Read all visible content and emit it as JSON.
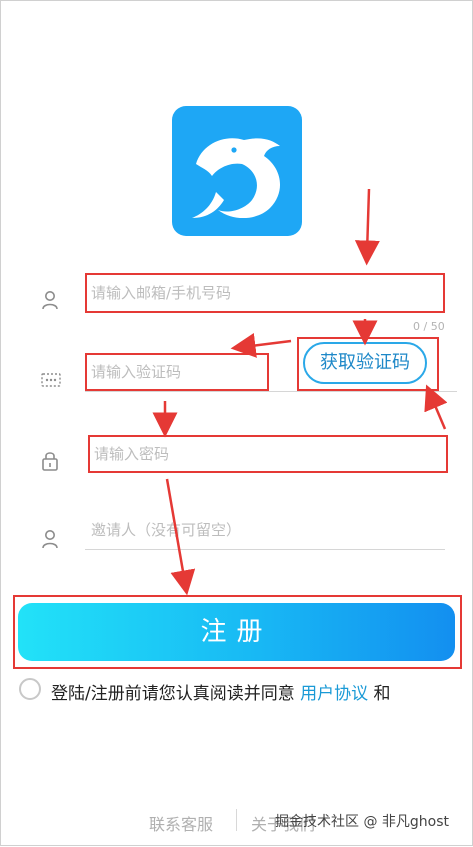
{
  "logo": {
    "icon": "dolphin-icon",
    "color": "#1ea7f5"
  },
  "form": {
    "account": {
      "placeholder": "请输入邮箱/手机号码",
      "counter": "0 / 50",
      "icon": "user-icon"
    },
    "code": {
      "placeholder": "请输入验证码",
      "button": "获取验证码",
      "icon": "dots-icon"
    },
    "password": {
      "placeholder": "请输入密码",
      "icon": "lock-icon"
    },
    "inviter": {
      "placeholder": "邀请人（没有可留空）",
      "icon": "user-icon"
    }
  },
  "register": {
    "label": "注册"
  },
  "agreement": {
    "text": "登陆/注册前请您认真阅读并同意",
    "link": "用户协议",
    "suffix": "和"
  },
  "footer": {
    "left": "联系客服",
    "right": "关于我们"
  },
  "watermark": "掘金技术社区 @ 非凡ghost",
  "colors": {
    "accent": "#1a9ad6",
    "annotation": "#e53935"
  }
}
